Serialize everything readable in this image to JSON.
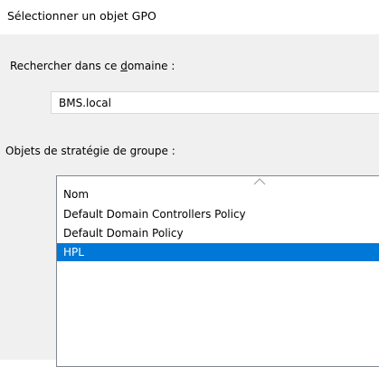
{
  "window": {
    "title": "Sélectionner un objet GPO"
  },
  "domain": {
    "label_before": "Rechercher dans ce ",
    "label_accel": "d",
    "label_after": "omaine :",
    "value": "BMS.local"
  },
  "gpo": {
    "label": "Objets de stratégie de groupe :",
    "column_header": "Nom",
    "sort_direction": "ascending",
    "items": [
      {
        "name": "Default Domain Controllers Policy",
        "selected": false
      },
      {
        "name": "Default Domain Policy",
        "selected": false
      },
      {
        "name": "HPL",
        "selected": true
      }
    ]
  },
  "colors": {
    "selection": "#0078d7",
    "dialog_background": "#f0f0f0"
  }
}
